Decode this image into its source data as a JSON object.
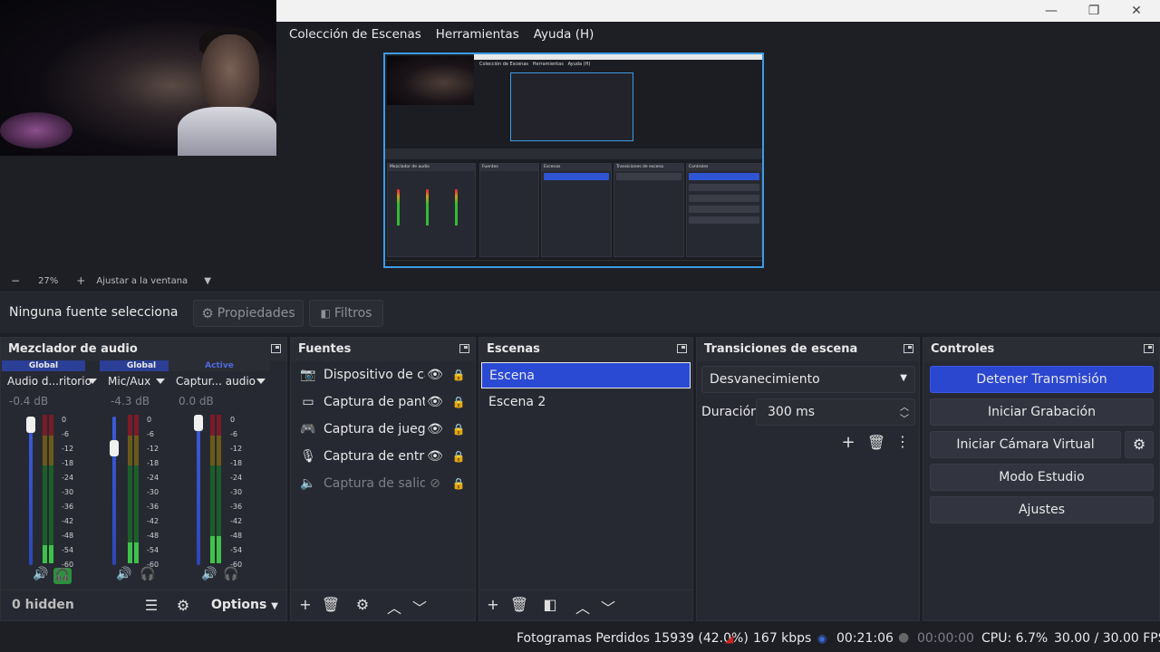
{
  "menu": {
    "scene_collection": "Colección de Escenas",
    "tools": "Herramientas",
    "help": "Ayuda (H)"
  },
  "window_controls": {
    "minimize": "—",
    "maximize": "❐",
    "close": "✕"
  },
  "zoom": {
    "minus": "−",
    "level": "27%",
    "plus": "+",
    "fit": "Ajustar a la ventana"
  },
  "source_toolbar": {
    "no_source": "Ninguna fuente selecciona",
    "properties": "Propiedades",
    "filters": "Filtros"
  },
  "mixer": {
    "title": "Mezclador de audio",
    "channels": [
      {
        "header": "Global",
        "name": "Audio d...ritorio",
        "db": "-0.4 dB",
        "level": 0.12
      },
      {
        "header": "Global",
        "name": "Mic/Aux",
        "db": "-4.3 dB",
        "level": 0.14
      },
      {
        "header": "Active",
        "name": "Captur... audio",
        "db": "0.0 dB",
        "level": 0.18
      }
    ],
    "scale": [
      "0",
      "-6",
      "-12",
      "-18",
      "-24",
      "-30",
      "-36",
      "-42",
      "-48",
      "-54",
      "-60"
    ],
    "hidden": "0 hidden",
    "options": "Options"
  },
  "sources": {
    "title": "Fuentes",
    "items": [
      {
        "label": "Dispositivo de cap",
        "icon": "camera-icon",
        "glyph": "📷",
        "visible": true
      },
      {
        "label": "Captura de pantall",
        "icon": "monitor-icon",
        "glyph": "▭",
        "visible": true
      },
      {
        "label": "Captura de juego",
        "icon": "gamepad-icon",
        "glyph": "⌨",
        "visible": true
      },
      {
        "label": "Captura de entrad",
        "icon": "microphone-icon",
        "glyph": "🎙",
        "visible": true
      },
      {
        "label": "Captura de salida (",
        "icon": "speaker-icon",
        "glyph": "🔈",
        "visible": false
      }
    ]
  },
  "scenes": {
    "title": "Escenas",
    "items": [
      "Escena",
      "Escena 2"
    ]
  },
  "transitions": {
    "title": "Transiciones de escena",
    "selected": "Desvanecimiento",
    "duration_label": "Duración",
    "duration_value": "300 ms"
  },
  "controls": {
    "title": "Controles",
    "stop_stream": "Detener Transmisión",
    "start_recording": "Iniciar Grabación",
    "start_virtual_cam": "Iniciar Cámara Virtual",
    "studio_mode": "Modo Estudio",
    "settings": "Ajustes"
  },
  "status": {
    "dropped_frames": "Fotogramas Perdidos 15939 (42.0%)",
    "bitrate": "167 kbps",
    "stream_time": "00:21:06",
    "rec_time": "00:00:00",
    "cpu": "CPU: 6.7%",
    "fps": "30.00 / 30.00 FPS"
  },
  "colors": {
    "accent": "#2b47d0",
    "preview_border": "#3c9ce6",
    "meter_green": "#3ec24a"
  }
}
